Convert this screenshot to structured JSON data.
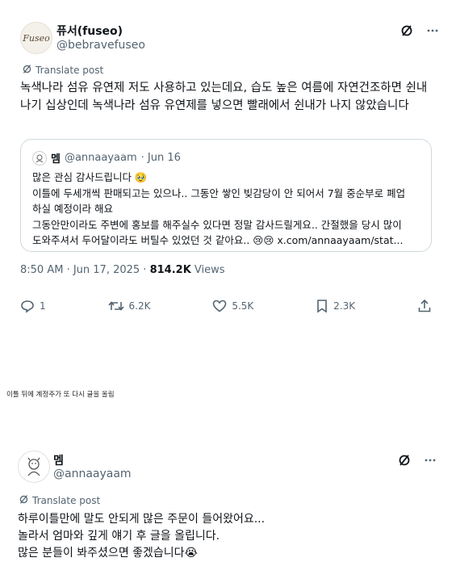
{
  "tweet1": {
    "author_name": "퓨서(fuseo)",
    "author_handle": "@bebravefuseo",
    "avatar_text": "Fuseo",
    "translate_label": "Translate post",
    "body": "녹색나라 섬유 유연제 저도 사용하고 있는데요, 습도 높은 여름에 자연건조하면 쉰내 나기 십상인데 녹색나라 섬유 유연제를 넣으면 빨래에서 쉰내가 나지 않았습니다",
    "quote": {
      "author_name": "멤",
      "author_handle": "@annaayaam",
      "date": "· Jun 16",
      "lines": [
        "많은 관심 감사드립니다 🥹",
        "이틀에 두세개씩 판매되고는 있으나.. 그동안 쌓인 빚감당이 안 되어서 7월 중순부로 폐업",
        "하실 예정이라 해요",
        "그동안만이라도 주변에 홍보를 해주실수 있다면 정말 감사드릴게요.. 간절했을 당시 많이",
        "도와주셔서 두어달이라도 버틸수 있었던 것 같아요.. 😢😢 x.com/annaayaam/stat..."
      ]
    },
    "meta": {
      "time_date": "8:50 AM · Jun 17, 2025 · ",
      "views_count": "814.2K",
      "views_label": " Views"
    },
    "actions": {
      "replies": "1",
      "reposts": "6.2K",
      "likes": "5.5K",
      "bookmarks": "2.3K"
    }
  },
  "caption": "이틀 뒤에 계정주가 또 다시 글을 올림",
  "tweet2": {
    "author_name": "멤",
    "author_handle": "@annaayaam",
    "translate_label": "Translate post",
    "lines": [
      "하루이틀만에 말도 안되게 많은 주문이 들어왔어요...",
      "놀라서 엄마와 깊게 얘기 후 글을 올립니다.",
      "많은 분들이 봐주셨으면 좋겠습니다😭"
    ]
  },
  "colors": {
    "text": "#0f1419",
    "secondary": "#536471",
    "border": "#cfd9de"
  }
}
